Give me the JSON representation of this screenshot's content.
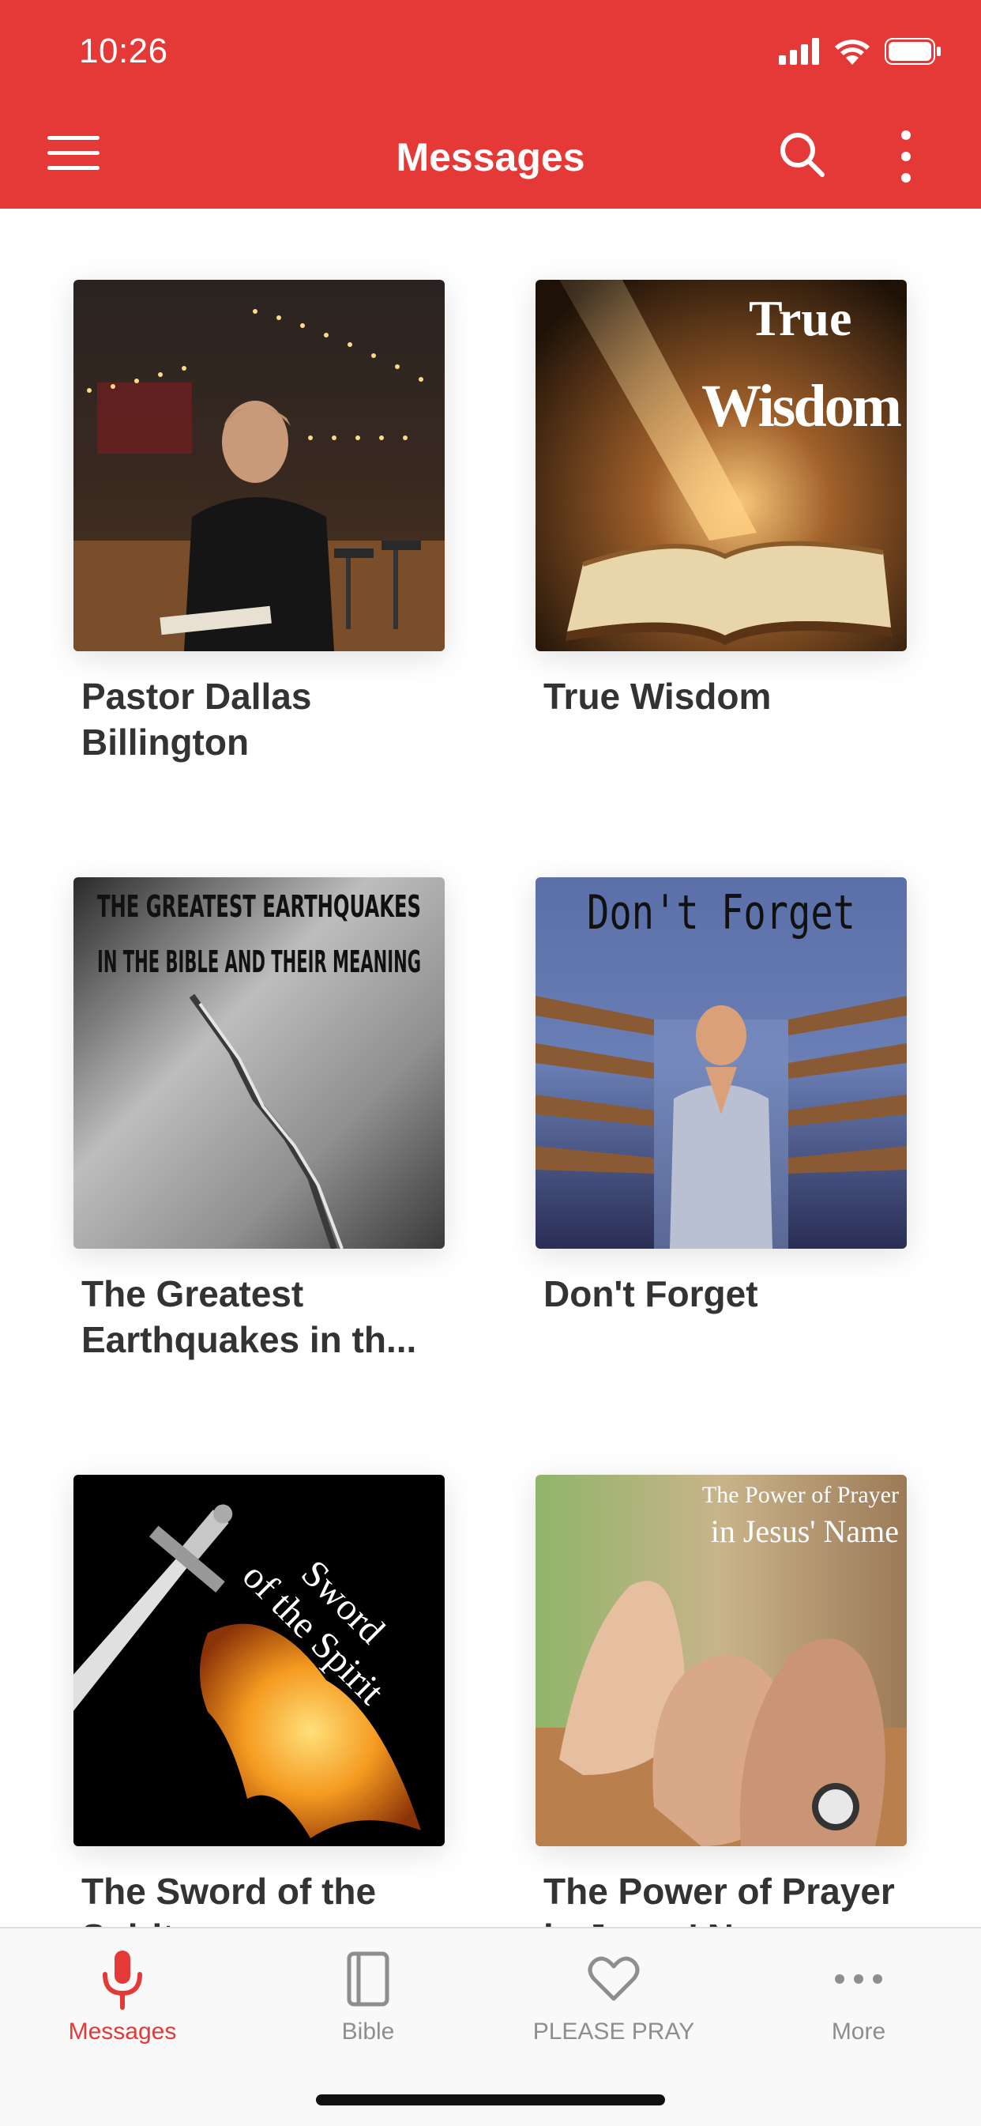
{
  "status_bar": {
    "time": "10:26"
  },
  "header": {
    "title": "Messages",
    "menu_icon": "hamburger-menu-icon",
    "search_icon": "search-icon",
    "more_icon": "more-vertical-icon"
  },
  "messages": [
    {
      "title": "Pastor Dallas Billington"
    },
    {
      "title": "True Wisdom",
      "overlay": "True Wisdom"
    },
    {
      "title": "The Greatest Earthquakes in th...",
      "overlay": "THE GREATEST EARTHQUAKES IN THE BIBLE AND THEIR MEANING"
    },
    {
      "title": "Don't Forget",
      "overlay": "Don't Forget"
    },
    {
      "title": "The Sword of the Spirit",
      "overlay": "Sword of the Spirit"
    },
    {
      "title": "The Power of Prayer in Jesus' Name",
      "overlay": "The Power of Prayer in Jesus' Name"
    }
  ],
  "tabs": [
    {
      "label": "Messages",
      "icon": "microphone-icon",
      "active": true
    },
    {
      "label": "Bible",
      "icon": "book-icon",
      "active": false
    },
    {
      "label": "PLEASE PRAY",
      "icon": "heart-icon",
      "active": false
    },
    {
      "label": "More",
      "icon": "more-horizontal-icon",
      "active": false
    }
  ],
  "colors": {
    "brand": "#e43936",
    "tab_inactive": "#8e8e8e",
    "title_text": "#333333"
  }
}
